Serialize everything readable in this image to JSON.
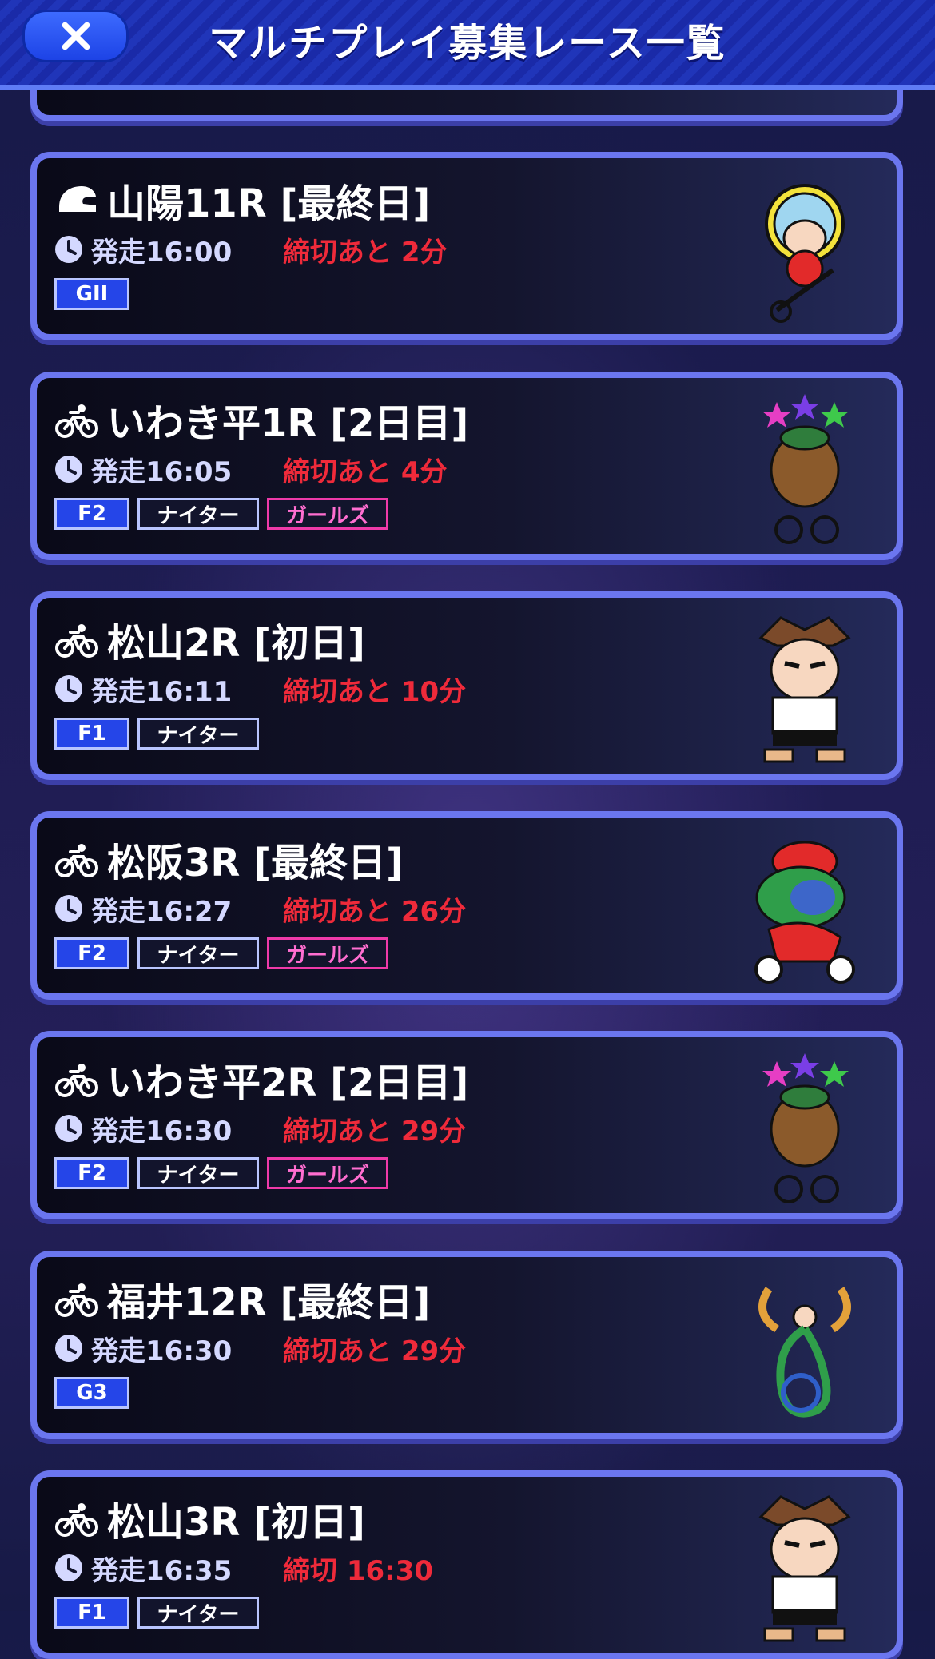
{
  "header": {
    "title": "マルチプレイ募集レース一覧",
    "close_icon": "close-icon"
  },
  "races": [
    {
      "name": "山陽11R [最終日]",
      "type_icon": "helmet-icon",
      "start": "発走16:00",
      "deadline": "締切あと 2分",
      "tags": [
        {
          "label": "GII",
          "kind": "grade"
        }
      ],
      "mascot": "mascot-rider-yellow"
    },
    {
      "name": "いわき平1R [2日目]",
      "type_icon": "bicycle-icon",
      "start": "発走16:05",
      "deadline": "締切あと 4分",
      "tags": [
        {
          "label": "F2",
          "kind": "grade"
        },
        {
          "label": "ナイター",
          "kind": "night"
        },
        {
          "label": "ガールズ",
          "kind": "girls"
        }
      ],
      "mascot": "mascot-beaver-stars"
    },
    {
      "name": "松山2R [初日]",
      "type_icon": "bicycle-icon",
      "start": "発走16:11",
      "deadline": "締切あと 10分",
      "tags": [
        {
          "label": "F1",
          "kind": "grade"
        },
        {
          "label": "ナイター",
          "kind": "night"
        }
      ],
      "mascot": "mascot-boy-arms-crossed"
    },
    {
      "name": "松阪3R [最終日]",
      "type_icon": "bicycle-icon",
      "start": "発走16:27",
      "deadline": "締切あと 26分",
      "tags": [
        {
          "label": "F2",
          "kind": "grade"
        },
        {
          "label": "ナイター",
          "kind": "night"
        },
        {
          "label": "ガールズ",
          "kind": "girls"
        }
      ],
      "mascot": "mascot-cow-cap"
    },
    {
      "name": "いわき平2R [2日目]",
      "type_icon": "bicycle-icon",
      "start": "発走16:30",
      "deadline": "締切あと 29分",
      "tags": [
        {
          "label": "F2",
          "kind": "grade"
        },
        {
          "label": "ナイター",
          "kind": "night"
        },
        {
          "label": "ガールズ",
          "kind": "girls"
        }
      ],
      "mascot": "mascot-beaver-stars"
    },
    {
      "name": "福井12R [最終日]",
      "type_icon": "bicycle-icon",
      "start": "発走16:30",
      "deadline": "締切あと 29分",
      "tags": [
        {
          "label": "G3",
          "kind": "grade"
        }
      ],
      "mascot": "mascot-phoenix-wheel"
    },
    {
      "name": "松山3R [初日]",
      "type_icon": "bicycle-icon",
      "start": "発走16:35",
      "deadline": "締切 16:30",
      "tags": [
        {
          "label": "F1",
          "kind": "grade"
        },
        {
          "label": "ナイター",
          "kind": "night"
        }
      ],
      "mascot": "mascot-boy-arms-crossed"
    }
  ],
  "colors": {
    "accent": "#6b76ef",
    "deadline": "#ef2a3a",
    "grade_tag": "#2545e8",
    "girls_tag": "#ef3aa9"
  }
}
